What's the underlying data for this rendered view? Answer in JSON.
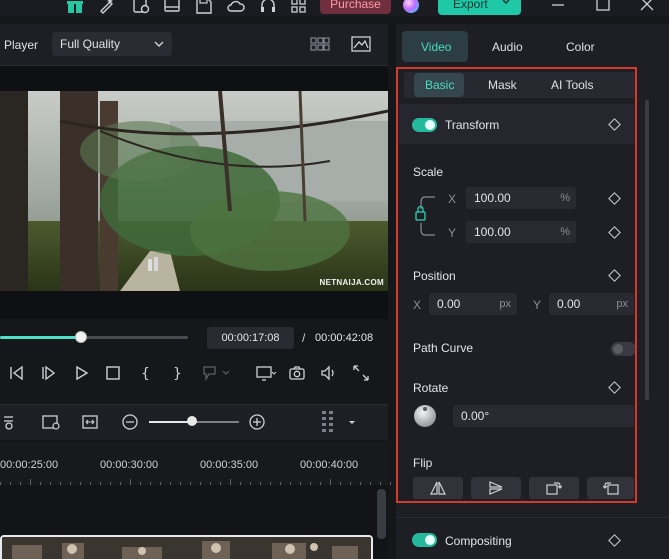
{
  "toolbar": {
    "purchase_label": "Purchase",
    "export_label": "Export",
    "icons": [
      "gift-icon",
      "pen-ai-icon",
      "audio-record-icon",
      "media-icon",
      "save-icon",
      "cloud-icon",
      "headset-icon",
      "grid-apps-icon",
      "minimize-icon",
      "maximize-icon",
      "close-icon"
    ],
    "accent_color": "#1fc8a6",
    "purchase_color": "#6f2f3c"
  },
  "player": {
    "label": "Player",
    "quality": "Full Quality",
    "watermark": "NETNAIJA.COM",
    "current_time": "00:00:17:08",
    "separator": "/",
    "total_time": "00:00:42:08",
    "progress_fraction": 0.43
  },
  "timeline": {
    "ruler_labels": [
      "00:00:25:00",
      "00:00:30:00",
      "00:00:35:00",
      "00:00:40:00"
    ],
    "zoom_fraction": 0.48
  },
  "panel": {
    "tabs": [
      "Video",
      "Audio",
      "Color"
    ],
    "active_tab": "Video",
    "subtabs": [
      "Basic",
      "Mask",
      "AI Tools"
    ],
    "active_subtab": "Basic",
    "transform": {
      "title": "Transform",
      "enabled": true,
      "scale": {
        "label": "Scale",
        "x_axis": "X",
        "x_value": "100.00",
        "x_unit": "%",
        "y_axis": "Y",
        "y_value": "100.00",
        "y_unit": "%"
      },
      "position": {
        "label": "Position",
        "x_axis": "X",
        "x_value": "0.00",
        "x_unit": "px",
        "y_axis": "Y",
        "y_value": "0.00",
        "y_unit": "px"
      },
      "path_curve": {
        "label": "Path Curve",
        "enabled": false
      },
      "rotate": {
        "label": "Rotate",
        "value": "0.00°"
      },
      "flip": {
        "label": "Flip",
        "buttons": [
          "flip-horizontal-icon",
          "flip-vertical-icon",
          "rotate-right-icon",
          "rotate-left-icon"
        ]
      }
    },
    "compositing": {
      "title": "Compositing",
      "enabled": true
    }
  }
}
